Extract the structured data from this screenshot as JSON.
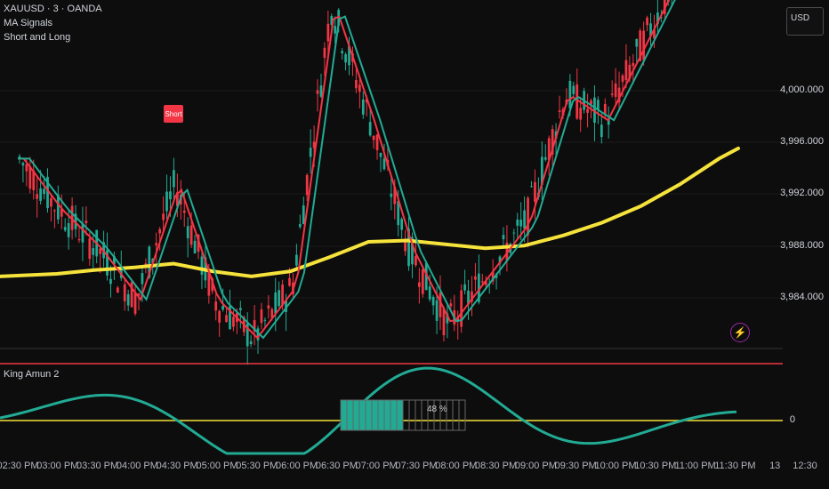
{
  "legend": {
    "symbol": "XAUUSD · 3 · OANDA",
    "indicator": "MA Signals",
    "subtitle": "Short and Long"
  },
  "currency": "USD",
  "signal_label": "Short",
  "price_axis": [
    "4,000.000",
    "3,996.000",
    "3,992.000",
    "3,988.000",
    "3,984.000"
  ],
  "lower_panel": {
    "title": "King Amun 2",
    "zero_label": "0",
    "progress_percent": "48 %",
    "progress_fraction": 0.48
  },
  "time_axis": [
    "02:30 PM",
    "03:00 PM",
    "03:30 PM",
    "04:00 PM",
    "04:30 PM",
    "05:00 PM",
    "05:30 PM",
    "06:00 PM",
    "06:30 PM",
    "07:00 PM",
    "07:30 PM",
    "08:00 PM",
    "08:30 PM",
    "09:00 PM",
    "09:30 PM",
    "10:00 PM",
    "10:30 PM",
    "11:00 PM",
    "11:30 PM",
    "13",
    "12:30"
  ],
  "colors": {
    "bull": "#22ab94",
    "bear": "#f23645",
    "ma_long": "#f5e23b",
    "upper_band": "#f23645",
    "zero_line": "#f5e23b"
  },
  "chart_data": {
    "type": "line",
    "x": [
      "02:30 PM",
      "03:00 PM",
      "03:30 PM",
      "04:00 PM",
      "04:30 PM",
      "05:00 PM",
      "05:30 PM",
      "06:00 PM",
      "06:30 PM",
      "07:00 PM",
      "07:30 PM",
      "08:00 PM",
      "08:30 PM",
      "09:00 PM",
      "09:30 PM",
      "10:00 PM",
      "10:30 PM",
      "11:00 PM",
      "11:30 PM"
    ],
    "series": [
      {
        "values": [
          3985.8,
          3986.0,
          3986.3,
          3986.5,
          3986.8,
          3986.2,
          3985.8,
          3986.2,
          3987.3,
          3988.5,
          3988.6,
          3988.3,
          3988.0,
          3988.2,
          3989.0,
          3990.0,
          3991.3,
          3993.0,
          3995.0
        ]
      },
      {
        "values": [
          3995,
          3991,
          3988,
          3984,
          3993,
          3984,
          3981,
          3985,
          4007,
          3998,
          3988,
          3982,
          3986,
          3990,
          4000,
          3998,
          4004,
          4010,
          4012
        ]
      }
    ],
    "ylim": [
      3981,
      4006
    ]
  }
}
